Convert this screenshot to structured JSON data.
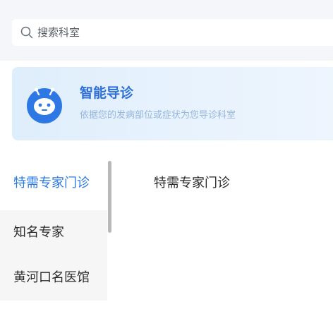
{
  "search": {
    "placeholder": "搜索科室"
  },
  "guide": {
    "title": "智能导诊",
    "subtitle": "依据您的发病部位或症状为您导诊科室",
    "accent_color": "#2e6fd8",
    "icon": "robot-icon"
  },
  "departments": [
    {
      "label": "特需专家门诊",
      "active": true
    },
    {
      "label": "知名专家",
      "active": false
    },
    {
      "label": "黄河口名医馆",
      "active": false
    }
  ],
  "content": {
    "title": "特需专家门诊"
  },
  "colors": {
    "active_text": "#2a79e1",
    "sidebar_bg": "#f6f6f6",
    "search_bg": "#f4f6f9"
  }
}
